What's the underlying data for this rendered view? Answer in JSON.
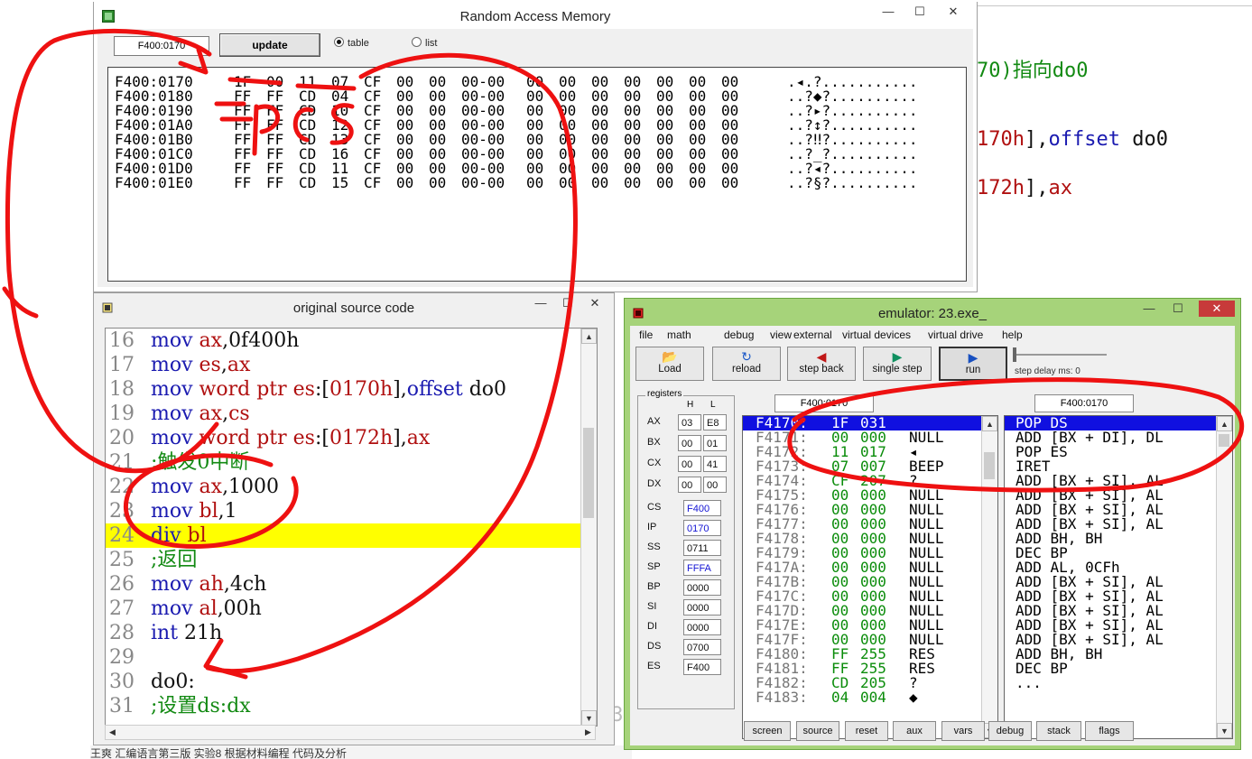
{
  "background_editor": {
    "lines": [
      {
        "parts": [
          [
            "c-green",
            "70)指向do0"
          ]
        ]
      },
      {
        "parts": [
          [
            "c-red",
            "170h"
          ],
          [
            "c-black",
            "],"
          ],
          [
            "c-blue",
            "offset"
          ],
          [
            "c-black",
            " do0"
          ]
        ]
      },
      {
        "parts": [
          [
            "c-red",
            "172h"
          ],
          [
            "c-black",
            "],"
          ],
          [
            "c-red",
            "ax"
          ]
        ]
      }
    ],
    "status_text": "王爽 汇编语言第三版 实验8 根据材料编程 代码及分析",
    "edge_digits": [
      "43"
    ]
  },
  "ram_window": {
    "title": "Random Access Memory",
    "address_value": "F400:0170",
    "update_label": "update",
    "radio_table": "table",
    "radio_list": "list",
    "rows": [
      {
        "addr": "F400:0170",
        "b": [
          "1F",
          "00",
          "11",
          "07",
          "CF",
          "00",
          "00",
          "00-00",
          "00",
          "00",
          "00",
          "00",
          "00",
          "00",
          "00"
        ],
        "ascii": ".◂.?..........."
      },
      {
        "addr": "F400:0180",
        "b": [
          "FF",
          "FF",
          "CD",
          "04",
          "CF",
          "00",
          "00",
          "00-00",
          "00",
          "00",
          "00",
          "00",
          "00",
          "00",
          "00"
        ],
        "ascii": "..?◆?.........."
      },
      {
        "addr": "F400:0190",
        "b": [
          "FF",
          "FF",
          "CD",
          "10",
          "CF",
          "00",
          "00",
          "00-00",
          "00",
          "00",
          "00",
          "00",
          "00",
          "00",
          "00"
        ],
        "ascii": "..?▸?.........."
      },
      {
        "addr": "F400:01A0",
        "b": [
          "FF",
          "FF",
          "CD",
          "12",
          "CF",
          "00",
          "00",
          "00-00",
          "00",
          "00",
          "00",
          "00",
          "00",
          "00",
          "00"
        ],
        "ascii": "..?↕?.........."
      },
      {
        "addr": "F400:01B0",
        "b": [
          "FF",
          "FF",
          "CD",
          "13",
          "CF",
          "00",
          "00",
          "00-00",
          "00",
          "00",
          "00",
          "00",
          "00",
          "00",
          "00"
        ],
        "ascii": "..?‼?.........."
      },
      {
        "addr": "F400:01C0",
        "b": [
          "FF",
          "FF",
          "CD",
          "16",
          "CF",
          "00",
          "00",
          "00-00",
          "00",
          "00",
          "00",
          "00",
          "00",
          "00",
          "00"
        ],
        "ascii": "..?_?.........."
      },
      {
        "addr": "F400:01D0",
        "b": [
          "FF",
          "FF",
          "CD",
          "11",
          "CF",
          "00",
          "00",
          "00-00",
          "00",
          "00",
          "00",
          "00",
          "00",
          "00",
          "00"
        ],
        "ascii": "..?◂?.........."
      },
      {
        "addr": "F400:01E0",
        "b": [
          "FF",
          "FF",
          "CD",
          "15",
          "CF",
          "00",
          "00",
          "00-00",
          "00",
          "00",
          "00",
          "00",
          "00",
          "00",
          "00"
        ],
        "ascii": "..?§?.........."
      }
    ]
  },
  "source_window": {
    "title": "original source code",
    "lines": [
      {
        "n": "16",
        "parts": [
          [
            "c-blue",
            "mov "
          ],
          [
            "c-red",
            "ax"
          ],
          [
            "c-black",
            ","
          ],
          [
            "c-black",
            "0f400h"
          ]
        ]
      },
      {
        "n": "17",
        "parts": [
          [
            "c-blue",
            "mov "
          ],
          [
            "c-red",
            "es"
          ],
          [
            "c-black",
            ","
          ],
          [
            "c-red",
            "ax"
          ]
        ]
      },
      {
        "n": "18",
        "parts": [
          [
            "c-blue",
            "mov "
          ],
          [
            "c-red",
            "word ptr es"
          ],
          [
            "c-black",
            ":["
          ],
          [
            "c-red",
            "0170h"
          ],
          [
            "c-black",
            "],"
          ],
          [
            "c-blue",
            "offset"
          ],
          [
            "c-black",
            " do0"
          ]
        ]
      },
      {
        "n": "19",
        "parts": [
          [
            "c-blue",
            "mov "
          ],
          [
            "c-red",
            "ax"
          ],
          [
            "c-black",
            ","
          ],
          [
            "c-red",
            "cs"
          ]
        ]
      },
      {
        "n": "20",
        "parts": [
          [
            "c-blue",
            "mov "
          ],
          [
            "c-red",
            "word ptr es"
          ],
          [
            "c-black",
            ":["
          ],
          [
            "c-red",
            "0172h"
          ],
          [
            "c-black",
            "],"
          ],
          [
            "c-red",
            "ax"
          ]
        ]
      },
      {
        "n": "21",
        "parts": [
          [
            "c-green",
            ";触发0中断"
          ]
        ]
      },
      {
        "n": "22",
        "parts": [
          [
            "c-blue",
            "mov "
          ],
          [
            "c-red",
            "ax"
          ],
          [
            "c-black",
            ",1000"
          ]
        ]
      },
      {
        "n": "23",
        "parts": [
          [
            "c-blue",
            "mov "
          ],
          [
            "c-red",
            "bl"
          ],
          [
            "c-black",
            ",1"
          ]
        ]
      },
      {
        "n": "24",
        "hl": true,
        "parts": [
          [
            "c-blue",
            "div "
          ],
          [
            "c-red",
            "bl"
          ]
        ]
      },
      {
        "n": "25",
        "parts": [
          [
            "c-green",
            ";返回"
          ]
        ]
      },
      {
        "n": "26",
        "parts": [
          [
            "c-blue",
            "mov "
          ],
          [
            "c-red",
            "ah"
          ],
          [
            "c-black",
            ",4ch"
          ]
        ]
      },
      {
        "n": "27",
        "parts": [
          [
            "c-blue",
            "mov "
          ],
          [
            "c-red",
            "al"
          ],
          [
            "c-black",
            ",00h"
          ]
        ]
      },
      {
        "n": "28",
        "parts": [
          [
            "c-blue",
            "int "
          ],
          [
            "c-black",
            "21h"
          ]
        ]
      },
      {
        "n": "29",
        "parts": []
      },
      {
        "n": "30",
        "parts": [
          [
            "c-black",
            "do0:"
          ]
        ]
      },
      {
        "n": "31",
        "parts": [
          [
            "c-green",
            ";设置ds:dx"
          ]
        ]
      }
    ]
  },
  "emulator_window": {
    "title": "emulator: 23.exe_",
    "menu": [
      "file",
      "math",
      "debug",
      "view",
      "external",
      "virtual devices",
      "virtual drive",
      "help"
    ],
    "tools": [
      {
        "label": "Load",
        "icon": "📂"
      },
      {
        "label": "reload",
        "icon": "↻"
      },
      {
        "label": "step back",
        "icon": "◀"
      },
      {
        "label": "single step",
        "icon": "▶"
      },
      {
        "label": "run",
        "icon": "▶"
      }
    ],
    "step_delay_label": "step delay ms: 0",
    "registers_label": "registers",
    "h_label": "H",
    "l_label": "L",
    "regs8": [
      {
        "name": "AX",
        "h": "03",
        "l": "E8"
      },
      {
        "name": "BX",
        "h": "00",
        "l": "01"
      },
      {
        "name": "CX",
        "h": "00",
        "l": "41"
      },
      {
        "name": "DX",
        "h": "00",
        "l": "00"
      }
    ],
    "regs16": [
      {
        "name": "CS",
        "v": "F400",
        "blue": true
      },
      {
        "name": "IP",
        "v": "0170",
        "blue": true
      },
      {
        "name": "SS",
        "v": "0711",
        "blue": false
      },
      {
        "name": "SP",
        "v": "FFFA",
        "blue": true
      },
      {
        "name": "BP",
        "v": "0000",
        "blue": false
      },
      {
        "name": "SI",
        "v": "0000",
        "blue": false
      },
      {
        "name": "DI",
        "v": "0000",
        "blue": false
      },
      {
        "name": "DS",
        "v": "0700",
        "blue": false
      },
      {
        "name": "ES",
        "v": "F400",
        "blue": false
      }
    ],
    "addr_left": "F400:0170",
    "addr_right": "F400:0170",
    "memory_list": [
      {
        "a": "F4170:",
        "h": "1F",
        "d": "031",
        "n": "",
        "sel": true
      },
      {
        "a": "F4171:",
        "h": "00",
        "d": "000",
        "n": "NULL"
      },
      {
        "a": "F4172:",
        "h": "11",
        "d": "017",
        "n": "◂"
      },
      {
        "a": "F4173:",
        "h": "07",
        "d": "007",
        "n": "BEEP"
      },
      {
        "a": "F4174:",
        "h": "CF",
        "d": "207",
        "n": "?"
      },
      {
        "a": "F4175:",
        "h": "00",
        "d": "000",
        "n": "NULL"
      },
      {
        "a": "F4176:",
        "h": "00",
        "d": "000",
        "n": "NULL"
      },
      {
        "a": "F4177:",
        "h": "00",
        "d": "000",
        "n": "NULL"
      },
      {
        "a": "F4178:",
        "h": "00",
        "d": "000",
        "n": "NULL"
      },
      {
        "a": "F4179:",
        "h": "00",
        "d": "000",
        "n": "NULL"
      },
      {
        "a": "F417A:",
        "h": "00",
        "d": "000",
        "n": "NULL"
      },
      {
        "a": "F417B:",
        "h": "00",
        "d": "000",
        "n": "NULL"
      },
      {
        "a": "F417C:",
        "h": "00",
        "d": "000",
        "n": "NULL"
      },
      {
        "a": "F417D:",
        "h": "00",
        "d": "000",
        "n": "NULL"
      },
      {
        "a": "F417E:",
        "h": "00",
        "d": "000",
        "n": "NULL"
      },
      {
        "a": "F417F:",
        "h": "00",
        "d": "000",
        "n": "NULL"
      },
      {
        "a": "F4180:",
        "h": "FF",
        "d": "255",
        "n": "RES"
      },
      {
        "a": "F4181:",
        "h": "FF",
        "d": "255",
        "n": "RES"
      },
      {
        "a": "F4182:",
        "h": "CD",
        "d": "205",
        "n": "?"
      },
      {
        "a": "F4183:",
        "h": "04",
        "d": "004",
        "n": "◆"
      }
    ],
    "disasm": [
      {
        "t": "POP DS",
        "sel": true
      },
      {
        "t": "ADD [BX + DI], DL"
      },
      {
        "t": "POP ES"
      },
      {
        "t": "IRET"
      },
      {
        "t": "ADD [BX + SI], AL"
      },
      {
        "t": "ADD [BX + SI], AL"
      },
      {
        "t": "ADD [BX + SI], AL"
      },
      {
        "t": "ADD [BX + SI], AL"
      },
      {
        "t": "ADD BH, BH"
      },
      {
        "t": "DEC BP"
      },
      {
        "t": "ADD AL, 0CFh"
      },
      {
        "t": "ADD [BX + SI], AL"
      },
      {
        "t": "ADD [BX + SI], AL"
      },
      {
        "t": "ADD [BX + SI], AL"
      },
      {
        "t": "ADD [BX + SI], AL"
      },
      {
        "t": "ADD [BX + SI], AL"
      },
      {
        "t": "ADD BH, BH"
      },
      {
        "t": "DEC BP"
      },
      {
        "t": "..."
      }
    ],
    "bottom_buttons": [
      "screen",
      "source",
      "reset",
      "aux",
      "vars",
      "debug",
      "stack",
      "flags"
    ]
  },
  "annotation": {
    "color": "#ee1111",
    "handwriting": "ip cs"
  }
}
